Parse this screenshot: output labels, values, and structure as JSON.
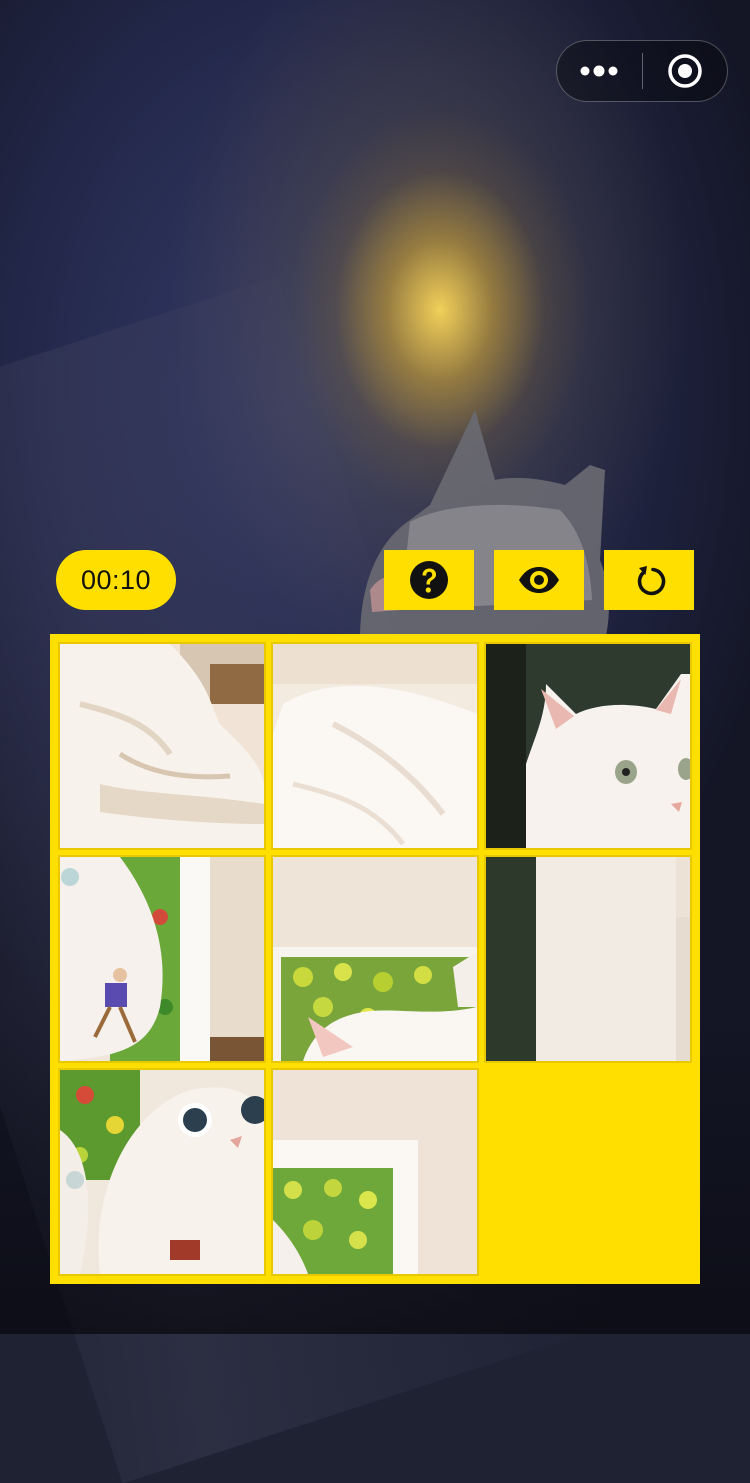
{
  "capsule": {
    "more_icon": "more-dots-icon",
    "close_icon": "target-circle-icon"
  },
  "toolbar": {
    "timer": "00:10",
    "hint_icon": "question-circle-icon",
    "preview_icon": "eye-icon",
    "restart_icon": "rotate-ccw-icon"
  },
  "colors": {
    "accent": "#ffdf00",
    "icon": "#111111"
  },
  "puzzle": {
    "rows": 3,
    "cols": 3,
    "tiles": [
      {
        "row": 0,
        "col": 0,
        "label": "cat-paw-piece"
      },
      {
        "row": 0,
        "col": 1,
        "label": "cat-fur-piece"
      },
      {
        "row": 0,
        "col": 2,
        "label": "cat-face-piece"
      },
      {
        "row": 1,
        "col": 0,
        "label": "painting-figure-piece"
      },
      {
        "row": 1,
        "col": 1,
        "label": "frame-green-piece"
      },
      {
        "row": 1,
        "col": 2,
        "label": "wall-dark-piece"
      },
      {
        "row": 2,
        "col": 0,
        "label": "painted-cat-piece"
      },
      {
        "row": 2,
        "col": 1,
        "label": "frame-corner-piece"
      }
    ],
    "empty_slot": {
      "row": 2,
      "col": 2
    }
  }
}
